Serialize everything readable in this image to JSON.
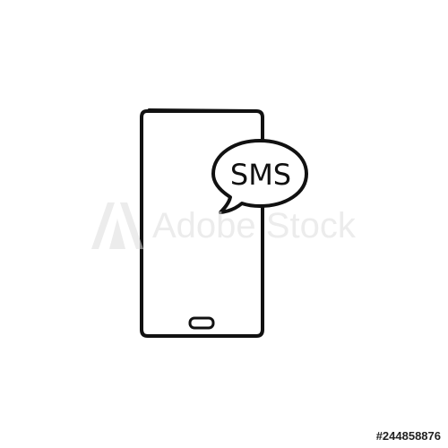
{
  "illustration": {
    "bubble_text": "SMS",
    "stroke_color": "#111111",
    "icons": [
      "smartphone-icon",
      "speech-bubble-icon",
      "home-button-icon"
    ]
  },
  "watermark": {
    "text": "Adobe Stock",
    "logo_icon": "adobe-logo-icon",
    "color": "#dcdcdc"
  },
  "stock_id": "#244858876"
}
